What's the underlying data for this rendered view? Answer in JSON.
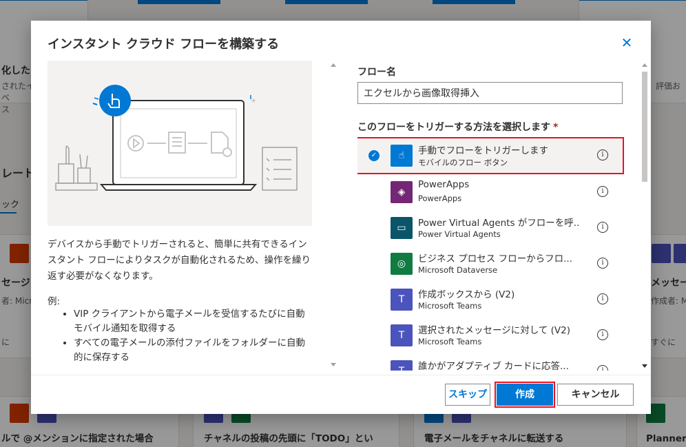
{
  "background": {
    "cards_top": [
      {
        "title": "化したク",
        "sub": "されたイベ\nス"
      },
      {
        "title": "",
        "sub": "評価お"
      }
    ],
    "left_section": {
      "heading": "レート",
      "tab": "ック"
    },
    "mid_cards": [
      {
        "title": "セージに",
        "author": "者: Micro",
        "tail": "に"
      },
      {
        "title": "メッセー",
        "author": "作成者: Mi",
        "tail": "すぐに"
      }
    ],
    "bottom_cards": [
      {
        "title": "ルで @メンションに指定された場合"
      },
      {
        "title": "チャネルの投稿の先頭に「TODO」とい"
      },
      {
        "title": "電子メールをチャネルに転送する"
      },
      {
        "title": "Planner タ"
      }
    ]
  },
  "dialog": {
    "title": "インスタント クラウド フローを構築する",
    "close_glyph": "✕",
    "description": "デバイスから手動でトリガーされると、簡単に共有できるインスタント フローによりタスクが自動化されるため、操作を繰り返す必要がなくなります。",
    "examples_label": "例:",
    "examples": [
      "VIP クライアントから電子メールを受信するたびに自動モバイル通知を取得する",
      "すべての電子メールの添付ファイルをフォルダーに自動的に保存する"
    ],
    "flow_name_label": "フロー名",
    "flow_name_value": "エクセルから画像取得挿入",
    "trigger_label": "このフローをトリガーする方法を選択します",
    "required_mark": "*",
    "triggers": [
      {
        "name": "手動でフローをトリガーします",
        "sub": "モバイルのフロー ボタン",
        "color": "#0078d4",
        "icon": "hand-tap-icon",
        "selected": true
      },
      {
        "name": "PowerApps",
        "sub": "PowerApps",
        "color": "#742774",
        "icon": "powerapps-icon",
        "selected": false
      },
      {
        "name": "Power Virtual Agents がフローを呼...",
        "sub": "Power Virtual Agents",
        "color": "#0b556a",
        "icon": "chat-bot-icon",
        "selected": false
      },
      {
        "name": "ビジネス プロセス フローからフロ...",
        "sub": "Microsoft Dataverse",
        "color": "#107c41",
        "icon": "dataverse-icon",
        "selected": false
      },
      {
        "name": "作成ボックスから (V2)",
        "sub": "Microsoft Teams",
        "color": "#4b53bc",
        "icon": "teams-icon",
        "selected": false
      },
      {
        "name": "選択されたメッセージに対して (V2)",
        "sub": "Microsoft Teams",
        "color": "#4b53bc",
        "icon": "teams-icon",
        "selected": false
      },
      {
        "name": "誰かがアダプティブ カードに応答...",
        "sub": "",
        "color": "#4b53bc",
        "icon": "teams-icon",
        "selected": false
      }
    ],
    "buttons": {
      "skip": "スキップ",
      "create": "作成",
      "cancel": "キャンセル"
    }
  }
}
